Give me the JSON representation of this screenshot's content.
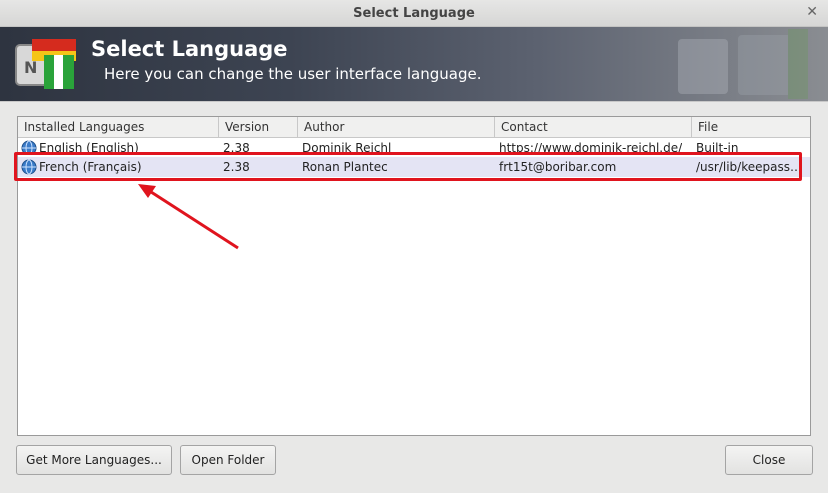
{
  "window": {
    "title": "Select Language"
  },
  "banner": {
    "heading": "Select Language",
    "subtitle": "Here you can change the user interface language."
  },
  "list": {
    "columns": [
      "Installed Languages",
      "Version",
      "Author",
      "Contact",
      "File"
    ],
    "rows": [
      {
        "language": "English (English)",
        "version": "2.38",
        "author": "Dominik Reichl",
        "contact": "https://www.dominik-reichl.de/",
        "file": "Built-in"
      },
      {
        "language": "French (Français)",
        "version": "2.38",
        "author": "Ronan Plantec",
        "contact": "frt15t@boribar.com",
        "file": "/usr/lib/keepass…"
      }
    ]
  },
  "buttons": {
    "get_more": "Get More Languages...",
    "open_folder": "Open Folder",
    "close": "Close"
  },
  "colors": {
    "highlight": "#e0141e",
    "selection": "#e4e4f4"
  }
}
